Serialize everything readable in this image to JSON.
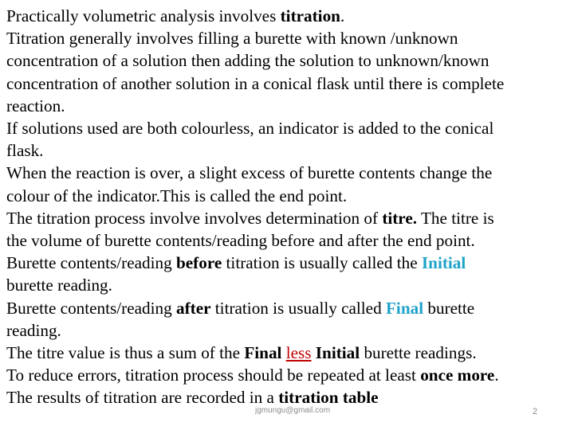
{
  "slide": {
    "colors": {
      "text": "#000000",
      "accent_blue": "#1fa3c9",
      "accent_red": "#c00000",
      "footer": "#8c8c8c"
    },
    "lines": [
      {
        "parts": [
          "Practically volumetric analysis involves ",
          "titration",
          "."
        ]
      },
      {
        "parts": [
          "Titration generally involves filling a burette with known /unknown"
        ]
      },
      {
        "parts": [
          "concentration of a solution then adding the solution to unknown/known"
        ]
      },
      {
        "parts": [
          "concentration of another solution in a conical flask until there is complete"
        ]
      },
      {
        "parts": [
          "reaction."
        ]
      },
      {
        "parts": [
          "If solutions used are both colourless, an indicator is added to the conical"
        ]
      },
      {
        "parts": [
          "flask."
        ]
      },
      {
        "parts": [
          "When the reaction is over, a slight excess of burette contents change the"
        ]
      },
      {
        "parts": [
          "colour of the indicator.This is called the end point."
        ]
      },
      {
        "parts": [
          "The titration process involve involves determination of ",
          "titre.",
          " The titre is"
        ]
      },
      {
        "parts": [
          "the volume of burette contents/reading before and after the end point."
        ]
      },
      {
        "parts": [
          " Burette contents/reading ",
          "before",
          " titration is usually called the ",
          "Initial"
        ]
      },
      {
        "parts": [
          "burette reading."
        ]
      },
      {
        "parts": [
          " Burette contents/reading ",
          "after",
          " titration is usually called  ",
          "Final",
          " burette"
        ]
      },
      {
        "parts": [
          "reading."
        ]
      },
      {
        "parts": [
          "The titre value is thus a sum of the ",
          "Final",
          " ",
          "less",
          " ",
          "Initial",
          " burette readings."
        ]
      },
      {
        "parts": [
          "To reduce errors, titration process should be repeated at least ",
          "once more",
          "."
        ]
      },
      {
        "parts": [
          "The results of titration are recorded in a ",
          "titration table"
        ]
      }
    ],
    "footer": {
      "email": "jgmungu@gmail.com",
      "page_number": "2"
    }
  }
}
